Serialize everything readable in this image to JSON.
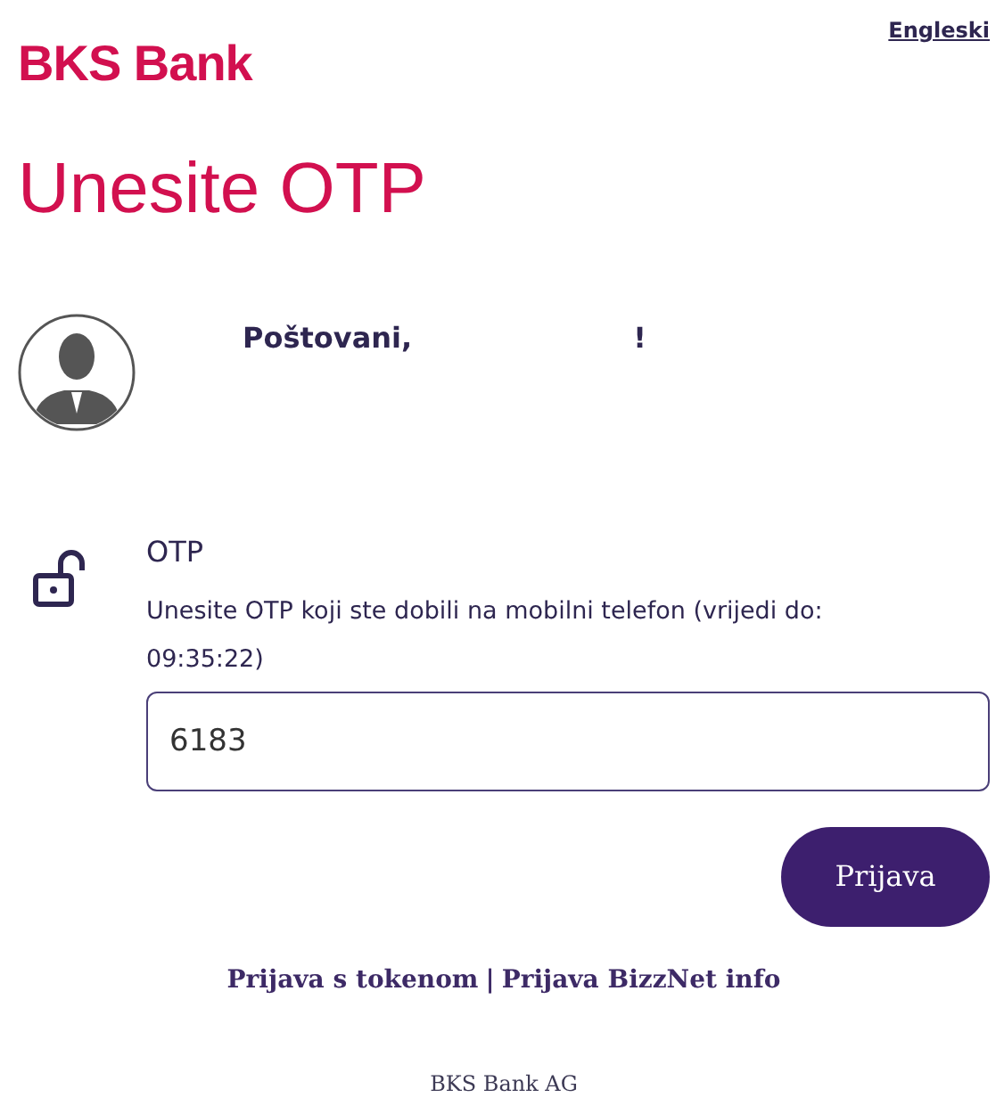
{
  "header": {
    "logo": "BKS Bank",
    "language_link": "Engleski"
  },
  "title": "Unesite OTP",
  "greeting": {
    "salutation": "Poštovani,",
    "end": "!"
  },
  "otp": {
    "label": "OTP",
    "hint": "Unesite OTP koji ste dobili na mobilni telefon (vrijedi do: 09:35:22)",
    "value": "6183"
  },
  "submit_button": "Prijava",
  "links": [
    "Prijava s tokenom",
    "Prijava BizzNet info"
  ],
  "links_separator": "|",
  "footer": "BKS Bank AG"
}
